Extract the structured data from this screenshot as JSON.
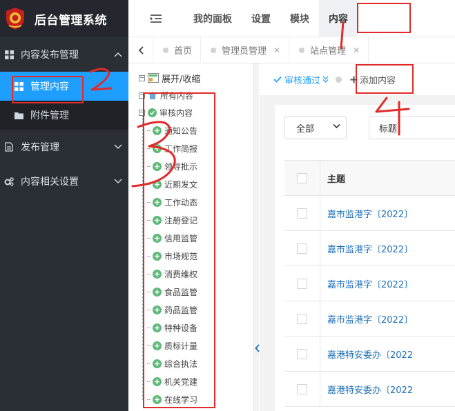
{
  "app": {
    "title": "后台管理系统"
  },
  "sidebar": {
    "groups": [
      {
        "label": "内容发布管理",
        "expanded": true
      },
      {
        "label": "发布管理",
        "expanded": false
      },
      {
        "label": "内容相关设置",
        "expanded": false
      }
    ],
    "submenu": [
      {
        "label": "管理内容",
        "active": true
      },
      {
        "label": "附件管理",
        "active": false
      }
    ]
  },
  "topnav": {
    "items": [
      "我的面板",
      "设置",
      "模块",
      "内容"
    ],
    "active_index": 3
  },
  "tabs": {
    "items": [
      {
        "label": "首页",
        "closable": false
      },
      {
        "label": "管理员管理",
        "closable": true
      },
      {
        "label": "站点管理",
        "closable": true
      }
    ]
  },
  "tree": {
    "toggle_label": "展开/收缩",
    "root": "所有内容",
    "parent": "审核内容",
    "children": [
      "通知公告",
      "工作简报",
      "领导批示",
      "近期发文",
      "工作动态",
      "注册登记",
      "信用监管",
      "市场规范",
      "消费维权",
      "食品监管",
      "药品监管",
      "特种设备",
      "质标计量",
      "综合执法",
      "机关党建",
      "在线学习"
    ]
  },
  "toolbar": {
    "approve_label": "审核通过",
    "add_label": "添加内容"
  },
  "filter": {
    "select_value": "全部",
    "field_label": "标题"
  },
  "table": {
    "header": "主题",
    "rows": [
      "嘉市监港字〔2022〕",
      "嘉市监港字〔2022〕",
      "嘉市监港字〔2022〕",
      "嘉市监港字〔2022〕",
      "嘉港特安委办〔2022",
      "嘉港特安委办〔2022"
    ]
  },
  "annotations": [
    "1",
    "2",
    "3",
    "4"
  ],
  "colors": {
    "sidebar_bg": "#2a2f36",
    "accent": "#1e9fff",
    "annotation": "#e12a2a",
    "tree_icon": "#5fb878"
  }
}
